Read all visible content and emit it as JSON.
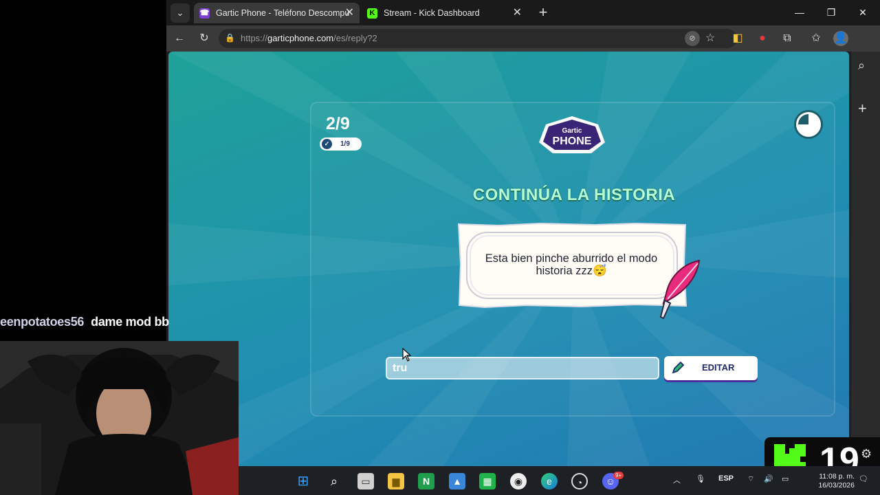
{
  "browser": {
    "tabs": [
      {
        "title": "Gartic Phone - Teléfono Descompu",
        "favicon": "phone-icon",
        "active": true
      },
      {
        "title": "Stream - Kick Dashboard",
        "favicon": "kick-icon",
        "active": false
      }
    ],
    "url": {
      "prefix": "https://",
      "domain": "garticphone.com",
      "path": "/es/reply?2"
    }
  },
  "game": {
    "round": "2/9",
    "done_count": "1/9",
    "logo": {
      "top": "Gartic",
      "bottom": "PHONE"
    },
    "heading": "CONTINÚA LA HISTORIA",
    "story_text": "Esta bien pinche aburrido el modo historia zzz😴",
    "answer_value": "tru",
    "edit_label": "EDITAR"
  },
  "overlay": {
    "chat_user": "eenpotatoes56",
    "chat_message": "dame mod bb",
    "viewer_count": "19"
  },
  "taskbar": {
    "language": "ESP",
    "time": "11:08 p. m.",
    "date": "16/03/2026",
    "discord_badge": "9+"
  },
  "colors": {
    "bg_start": "#1fa198",
    "bg_end": "#2379b3",
    "heading": "#b6ffd4",
    "kick_green": "#53fc18"
  }
}
